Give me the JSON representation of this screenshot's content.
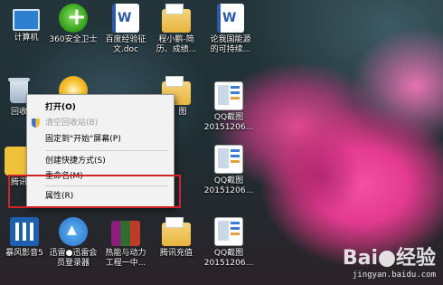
{
  "desktop": {
    "icons": [
      {
        "label": "计算机"
      },
      {
        "label": "360安全卫士"
      },
      {
        "label": "百度经验征\n文.doc"
      },
      {
        "label": "程小鹏-简\n历、成绩..."
      },
      {
        "label": "论我国能源\n的可持续..."
      },
      {
        "label": "回收站"
      },
      {
        "label": ""
      },
      {
        "label": ""
      },
      {
        "label": "QQ截图\n20151206..."
      },
      {
        "label": "QQ截图\n20151206..."
      },
      {
        "label": "暴风影音5"
      },
      {
        "label": "迅雷●迅雷会\n员登录器"
      },
      {
        "label": "热能与动力\n工程一中..."
      },
      {
        "label": "腾讯充值"
      },
      {
        "label": "QQ截图\n20151206..."
      }
    ],
    "partial_labels": {
      "recycle_bin_left": "回收",
      "tencent_left": "腾讯",
      "qq_side": "图"
    }
  },
  "context_menu": {
    "items": [
      {
        "label": "打开(O)"
      },
      {
        "label": "清空回收站(B)"
      },
      {
        "label": "固定到\"开始\"屏幕(P)"
      },
      {
        "label": "创建快捷方式(S)"
      },
      {
        "label": "重命名(M)"
      },
      {
        "label": "属性(R)"
      }
    ]
  },
  "watermark": {
    "logo_left": "Bai",
    "logo_right": "经验",
    "url": "jingyan.baidu.com"
  },
  "colors": {
    "highlight_border": "#d2232a",
    "menu_bg": "#f2f2f2"
  }
}
